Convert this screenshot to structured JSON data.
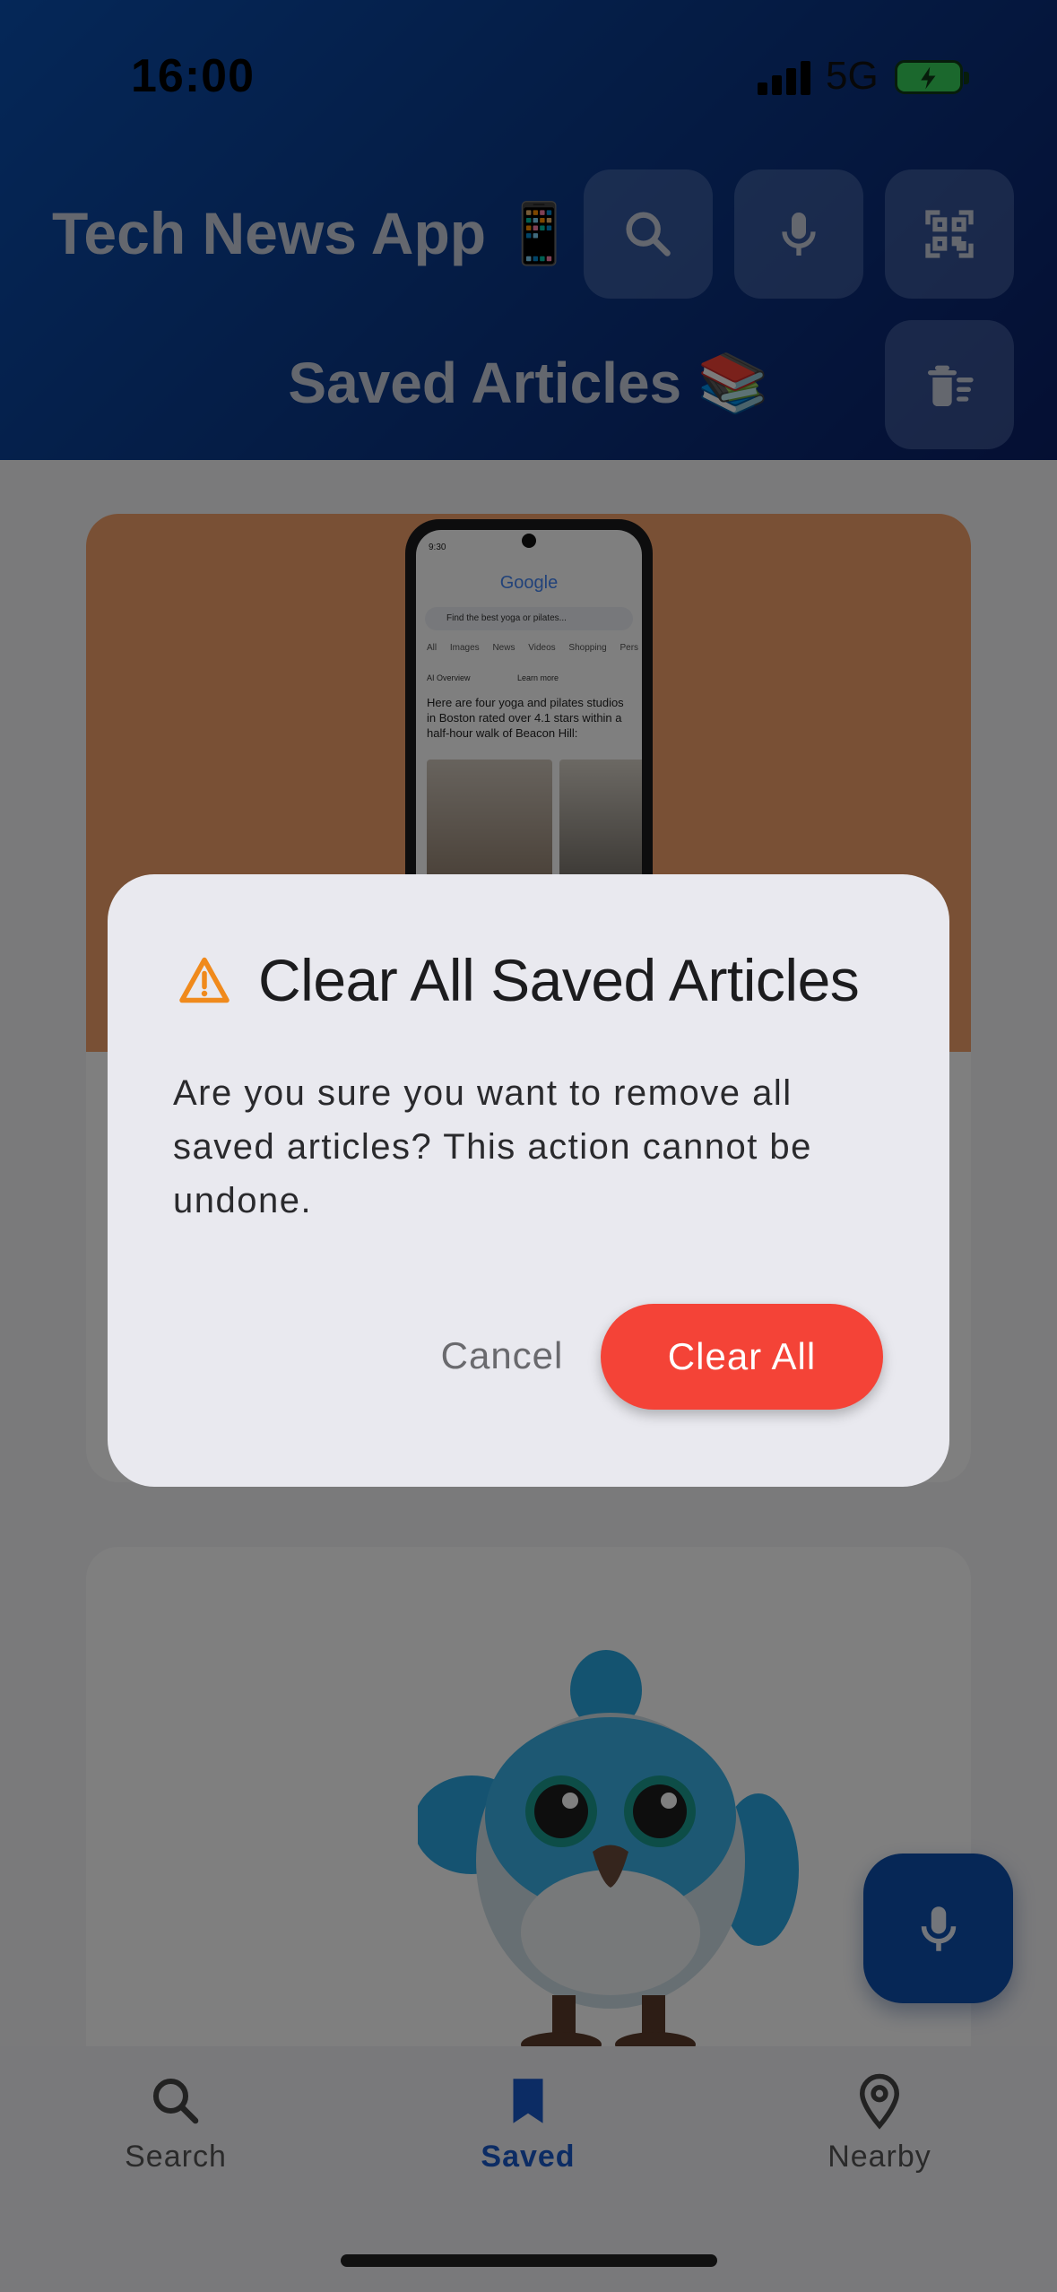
{
  "status_bar": {
    "time": "16:00",
    "network": "5G"
  },
  "header": {
    "app_title": "Tech News App 📱",
    "section_title": "Saved Articles 📚",
    "buttons": [
      "search-icon",
      "mic-icon",
      "qr-scan-icon",
      "clear-all-icon"
    ]
  },
  "cards": [
    {
      "image_phone": {
        "status": "9:30",
        "logo": "Google",
        "search_text": "Find the best yoga or pilates...",
        "tabs": "All Images News Videos Shopping Pers",
        "overview_label": "AI Overview",
        "overview_learn": "Learn more",
        "overview_text": "Here are four yoga and pilates studios in Boston rated over 4.1 stars within a half-hour walk of Beacon Hill:"
      }
    },
    {
      "image": "owl-mascot"
    }
  ],
  "fab": {
    "icon": "mic-icon"
  },
  "bottom_nav": {
    "items": [
      {
        "label": "Search",
        "icon": "search-icon"
      },
      {
        "label": "Saved",
        "icon": "bookmark-icon",
        "active": true
      },
      {
        "label": "Nearby",
        "icon": "location-pin-icon"
      }
    ]
  },
  "dialog": {
    "title": "Clear All Saved Articles",
    "message": "Are you sure you want to remove all saved articles? This action cannot be undone.",
    "cancel_label": "Cancel",
    "confirm_label": "Clear All",
    "confirm_color": "#f44337",
    "warning_color": "#f08a1c"
  },
  "colors": {
    "accent": "#1958c8",
    "header_start": "#0b4fb0",
    "header_end": "#0a1f66"
  }
}
